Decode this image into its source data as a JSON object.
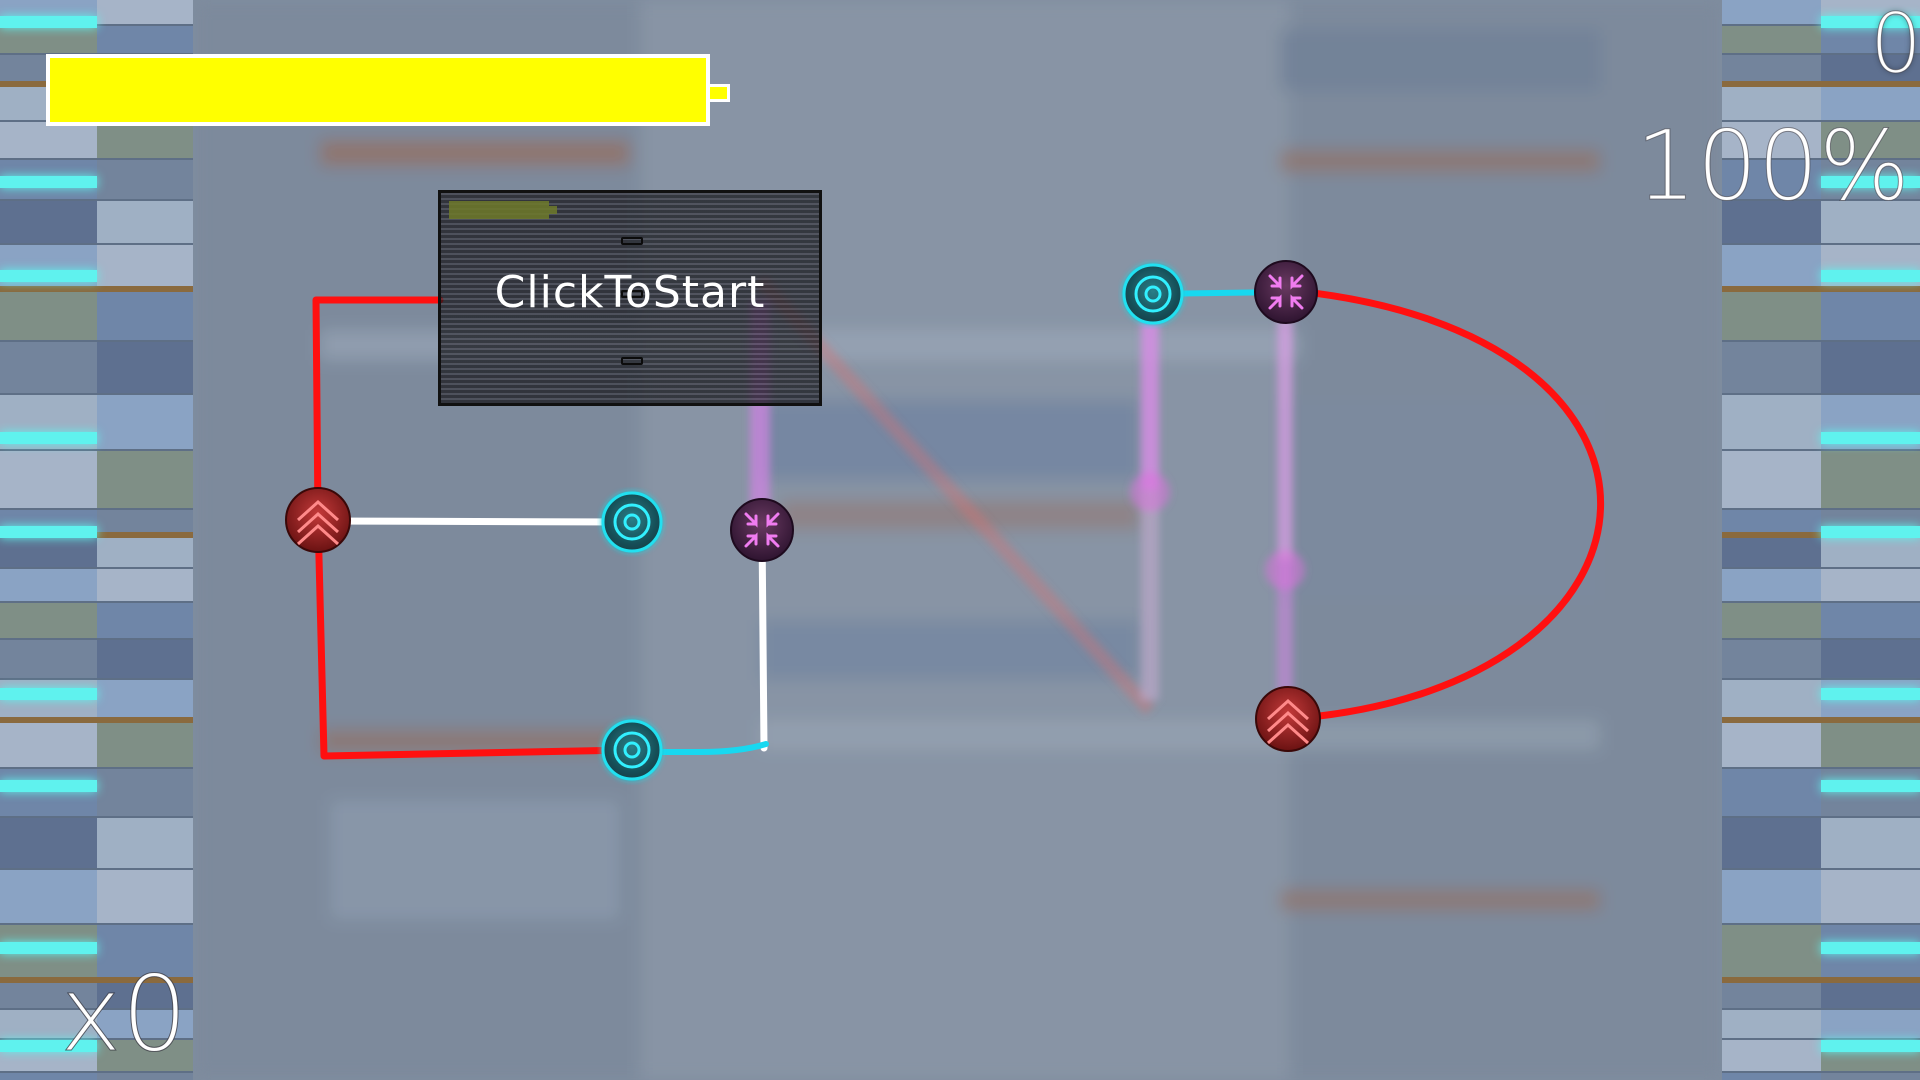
{
  "hud": {
    "health_fraction": 1.0,
    "score": "0",
    "accuracy": "100%",
    "combo": "x0"
  },
  "start_panel": {
    "label": "ClickToStart",
    "progress_fraction": 0.28
  },
  "colors": {
    "health_fill": "#ffff00",
    "track_red": "#ff1010",
    "track_white": "#ffffff",
    "track_cyan": "#18d8f0",
    "track_magenta": "#d070e0",
    "side_glow": "#5ff2ee"
  },
  "notes": [
    {
      "type": "tap",
      "icon": "target-ring-icon"
    },
    {
      "type": "tap",
      "icon": "target-ring-icon"
    },
    {
      "type": "tap",
      "icon": "target-ring-icon"
    },
    {
      "type": "hold",
      "icon": "double-chevron-up-icon"
    },
    {
      "type": "hold",
      "icon": "double-chevron-up-icon"
    },
    {
      "type": "compress",
      "icon": "compress-arrows-icon"
    },
    {
      "type": "compress",
      "icon": "compress-arrows-icon"
    }
  ]
}
